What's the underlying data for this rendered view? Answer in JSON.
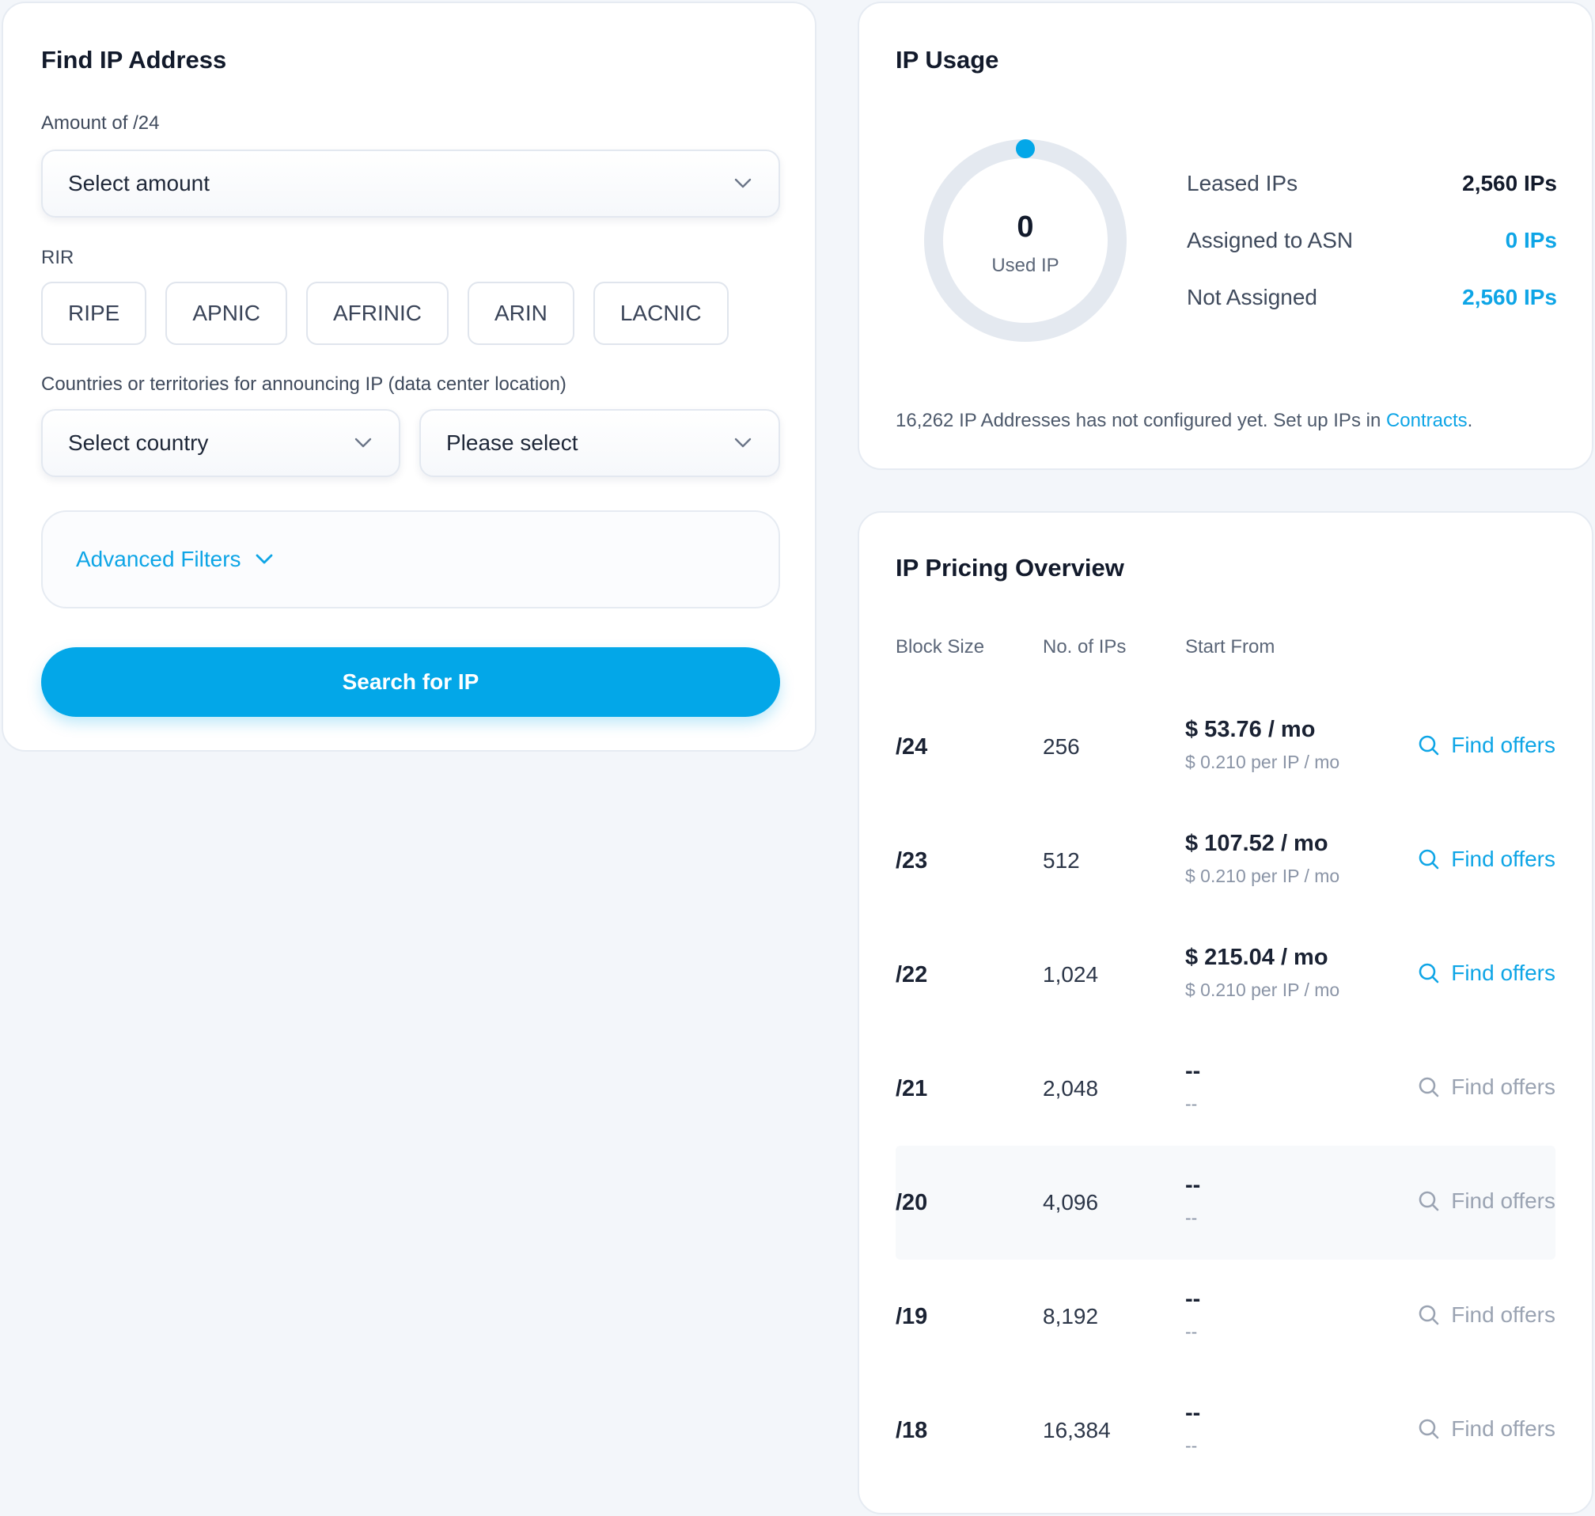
{
  "colors": {
    "accent": "#03a7e8",
    "link": "#0ea5e6",
    "muted": "#9aa3b2",
    "donut_track": "#e4e9f0"
  },
  "find": {
    "title": "Find IP Address",
    "amount_label": "Amount of /24",
    "amount_value": "Select amount",
    "rir_label": "RIR",
    "rir_options": [
      "RIPE",
      "APNIC",
      "AFRINIC",
      "ARIN",
      "LACNIC"
    ],
    "countries_label": "Countries or territories for announcing IP (data center location)",
    "country_value": "Select country",
    "region_value": "Please select",
    "advanced_filters": "Advanced Filters",
    "search_button": "Search for IP"
  },
  "usage": {
    "title": "IP Usage",
    "used_count": "0",
    "used_caption": "Used IP",
    "used_fraction": 0,
    "stats": [
      {
        "label": "Leased IPs",
        "value": "2,560 IPs",
        "color": "#121a2b"
      },
      {
        "label": "Assigned to ASN",
        "value": "0 IPs",
        "color": "#0ea5e6"
      },
      {
        "label": "Not Assigned",
        "value": "2,560 IPs",
        "color": "#0ea5e6"
      }
    ],
    "note_text": "16,262 IP Addresses has not configured yet. Set up IPs in ",
    "note_link": "Contracts",
    "note_end": "."
  },
  "pricing": {
    "title": "IP Pricing Overview",
    "headers": [
      "Block Size",
      "No. of IPs",
      "Start From"
    ],
    "find_label": "Find offers",
    "rows": [
      {
        "block": "/24",
        "ips": "256",
        "price": "$ 53.76 / mo",
        "per_ip": "$ 0.210 per IP / mo",
        "available": true
      },
      {
        "block": "/23",
        "ips": "512",
        "price": "$ 107.52 / mo",
        "per_ip": "$ 0.210 per IP / mo",
        "available": true
      },
      {
        "block": "/22",
        "ips": "1,024",
        "price": "$ 215.04 / mo",
        "per_ip": "$ 0.210 per IP / mo",
        "available": true
      },
      {
        "block": "/21",
        "ips": "2,048",
        "price": "--",
        "per_ip": "--",
        "available": false
      },
      {
        "block": "/20",
        "ips": "4,096",
        "price": "--",
        "per_ip": "--",
        "available": false
      },
      {
        "block": "/19",
        "ips": "8,192",
        "price": "--",
        "per_ip": "--",
        "available": false
      },
      {
        "block": "/18",
        "ips": "16,384",
        "price": "--",
        "per_ip": "--",
        "available": false
      }
    ]
  }
}
